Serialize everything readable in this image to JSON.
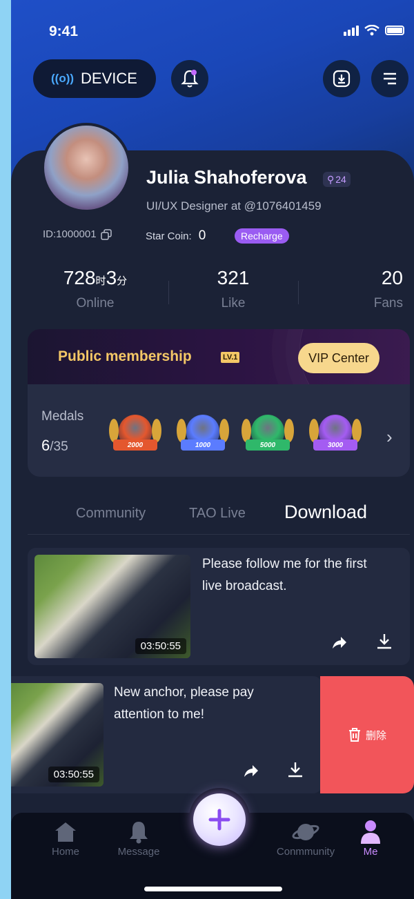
{
  "status": {
    "time": "9:41"
  },
  "header": {
    "device_label": "DEVICE",
    "device_wave": "((o))"
  },
  "profile": {
    "name": "Julia Shahoferova",
    "level_badge": "24",
    "subtitle": "UI/UX Designer at @1076401459",
    "id_text": "ID:1000001",
    "star_coin_label": "Star Coin:",
    "star_coin_value": "0",
    "recharge_label": "Recharge"
  },
  "stats": {
    "online_value": "728",
    "online_unit1": "时",
    "online_value2": "3",
    "online_unit2": "分",
    "online_label": "Online",
    "like_value": "321",
    "like_label": "Like",
    "fans_value": "20",
    "fans_label": "Fans"
  },
  "membership": {
    "title": "Public membership",
    "level": "LV.1",
    "vip_button": "VIP Center"
  },
  "medals": {
    "label": "Medals",
    "count": "6",
    "total": "/35",
    "items": [
      {
        "ribbon": "2000",
        "color": "#e4572e"
      },
      {
        "ribbon": "1000",
        "color": "#5b7cff"
      },
      {
        "ribbon": "5000",
        "color": "#2fb86a"
      },
      {
        "ribbon": "3000",
        "color": "#a45cf2"
      }
    ]
  },
  "tabs": {
    "community": "Community",
    "tao_live": "TAO Live",
    "download": "Download"
  },
  "videos": [
    {
      "title_line1": "Please follow me for the first",
      "title_line2": "live broadcast.",
      "duration": "03:50:55"
    },
    {
      "title_line1": "New anchor, please pay",
      "title_line2": "attention to me!",
      "duration": "03:50:55"
    }
  ],
  "delete_label": "删除",
  "tabbar": {
    "home": "Home",
    "message": "Message",
    "community": "Conmmunity",
    "me": "Me"
  },
  "colors": {
    "accent": "#9a5cf2",
    "delete": "#f2555a",
    "gold": "#f3c766"
  }
}
